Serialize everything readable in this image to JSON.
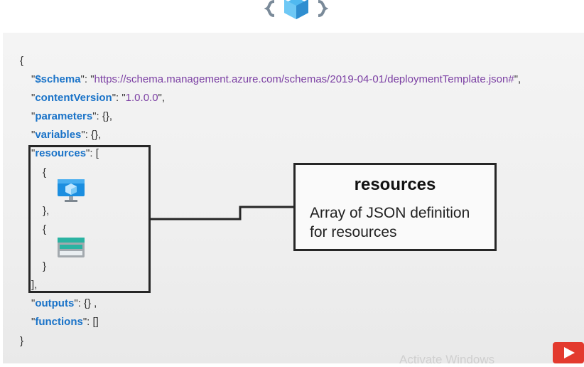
{
  "code": {
    "open_brace": "{",
    "close_brace": "}",
    "schema": {
      "key": "$schema",
      "value": "https://schema.management.azure.com/schemas/2019-04-01/deploymentTemplate.json#"
    },
    "content_version": {
      "key": "contentVersion",
      "value": "1.0.0.0"
    },
    "parameters": {
      "key": "parameters",
      "value": "{},"
    },
    "variables": {
      "key": "variables",
      "value": "{},"
    },
    "resources": {
      "key": "resources",
      "open": "[",
      "close": "],"
    },
    "resource_items": [
      {
        "open": "{",
        "close": "},",
        "icon": "virtual-machine-icon"
      },
      {
        "open": "{",
        "close": "}",
        "icon": "storage-account-icon"
      }
    ],
    "outputs": {
      "key": "outputs",
      "value": "{} ,"
    },
    "functions": {
      "key": "functions",
      "value": "[]"
    }
  },
  "callout": {
    "title": "resources",
    "body_line1": "Array of JSON definition",
    "body_line2": "for resources"
  },
  "watermark": "Activate Windows",
  "colors": {
    "key": "#1a73c8",
    "string": "#7b3fa3",
    "box_border": "#262626",
    "logo": "#3aa3e3"
  },
  "icons": [
    "arm-template-logo-icon",
    "virtual-machine-icon",
    "storage-account-icon",
    "play-icon"
  ]
}
